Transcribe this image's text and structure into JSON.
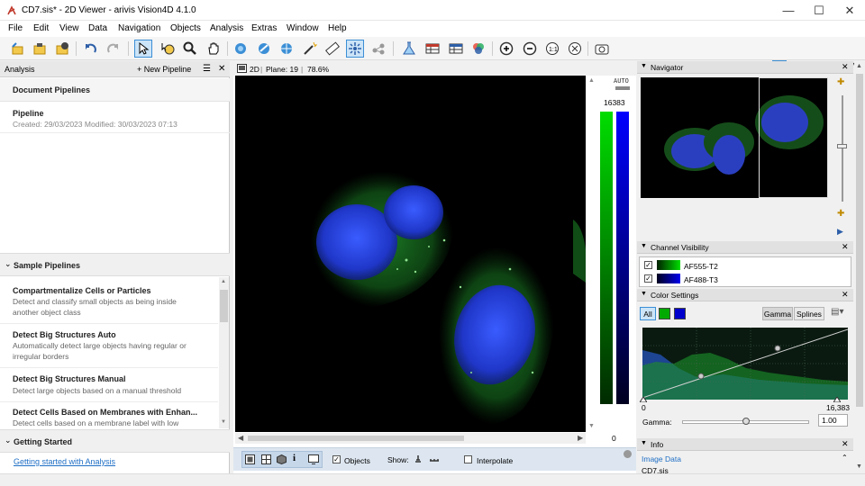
{
  "window": {
    "title": "CD7.sis* - 2D Viewer - arivis Vision4D 4.1.0"
  },
  "menu": [
    "File",
    "Edit",
    "View",
    "Data",
    "Navigation",
    "Objects",
    "Analysis",
    "Extras",
    "Window",
    "Help"
  ],
  "left_panel": {
    "title": "Analysis",
    "new_pipeline_label": "New Pipeline",
    "document_pipelines_label": "Document Pipelines",
    "pipeline": {
      "name": "Pipeline",
      "meta": "Created: 29/03/2023   Modified: 30/03/2023 07:13"
    },
    "sample_pipelines_label": "Sample Pipelines",
    "samples": [
      {
        "title": "Compartmentalize Cells or Particles",
        "desc": "Detect and classify small objects as being inside another object class"
      },
      {
        "title": "Detect Big Structures Auto",
        "desc": "Automatically detect large objects having regular or irregular borders"
      },
      {
        "title": "Detect Big Structures Manual",
        "desc": "Detect large objects based on a manual threshold"
      },
      {
        "title": "Detect Cells Based on Membranes with Enhan...",
        "desc": "Detect cells based on a membrane label with low"
      }
    ],
    "getting_started_label": "Getting Started",
    "getting_started_link": "Getting started with Analysis"
  },
  "viewer": {
    "mode": "2D",
    "plane": "Plane: 19",
    "zoom": "78.6%",
    "lut_auto": "AUTO",
    "lut_max": "16383",
    "lut_min": "0",
    "bottom": {
      "objects_label": "Objects",
      "show_label": "Show:",
      "interpolate_label": "Interpolate",
      "objects_checked": true,
      "interpolate_checked": false
    }
  },
  "right_panel": {
    "navigator_label": "Navigator",
    "channel_visibility_label": "Channel Visibility",
    "channels": [
      {
        "name": "AF555-T2",
        "color": "#00cc00",
        "checked": true
      },
      {
        "name": "AF488-T3",
        "color": "#0000ee",
        "checked": true
      }
    ],
    "color_settings_label": "Color Settings",
    "all_label": "All",
    "gamma_btn": "Gamma",
    "splines_btn": "Splines",
    "range_min": "0",
    "range_max": "16,383",
    "gamma_label": "Gamma:",
    "gamma_value": "1.00",
    "info_label": "Info",
    "image_data_label": "Image Data",
    "file_name": "CD7.sis"
  },
  "colors": {
    "accent": "#1f6fc5",
    "green_channel": "#00cc00",
    "blue_channel": "#0000ee"
  }
}
